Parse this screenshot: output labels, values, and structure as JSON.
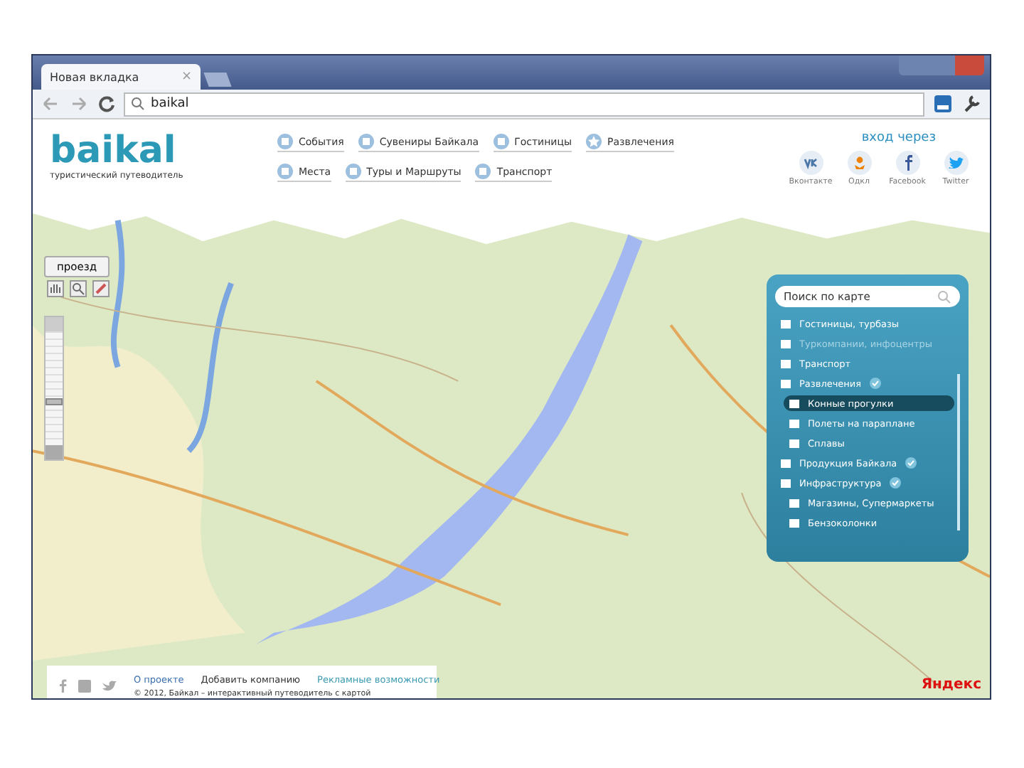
{
  "browser": {
    "tab": {
      "title": "Новая вкладка",
      "close": "×"
    },
    "address": "baikal"
  },
  "site": {
    "logo": "baikal",
    "tagline": "туристический путеводитель",
    "nav": [
      {
        "label": "События"
      },
      {
        "label": "Сувениры Байкала"
      },
      {
        "label": "Гостиницы"
      },
      {
        "label": "Развлечения"
      },
      {
        "label": "Места"
      },
      {
        "label": "Туры и Маршруты"
      },
      {
        "label": "Транспорт"
      }
    ],
    "login": {
      "title": "вход через",
      "networks": [
        {
          "label": "Вконтакте"
        },
        {
          "label": "Одкл"
        },
        {
          "label": "Facebook"
        },
        {
          "label": "Twitter"
        }
      ]
    }
  },
  "map": {
    "route_button": "проезд",
    "zoom": {
      "level": 0.35
    },
    "panel": {
      "search": {
        "placeholder": "Поиск по карте"
      },
      "items": [
        {
          "label": "Гостиницы, турбазы",
          "kind": "category",
          "selected": false,
          "disabled": false,
          "checked": false
        },
        {
          "label": "Туркомпании, инфоцентры",
          "kind": "category",
          "selected": false,
          "disabled": true,
          "checked": false
        },
        {
          "label": "Транспорт",
          "kind": "category",
          "selected": false,
          "disabled": false,
          "checked": false
        },
        {
          "label": "Развлечения",
          "kind": "category",
          "selected": false,
          "disabled": false,
          "checked": true
        },
        {
          "label": "Конные прогулки",
          "kind": "sub",
          "selected": true,
          "disabled": false,
          "checked": false
        },
        {
          "label": "Полеты на параплане",
          "kind": "sub",
          "selected": false,
          "disabled": false,
          "checked": false
        },
        {
          "label": "Сплавы",
          "kind": "sub",
          "selected": false,
          "disabled": false,
          "checked": false
        },
        {
          "label": "Продукция Байкала",
          "kind": "category",
          "selected": false,
          "disabled": false,
          "checked": true
        },
        {
          "label": "Инфраструктура",
          "kind": "category",
          "selected": false,
          "disabled": false,
          "checked": true
        },
        {
          "label": "Магазины, Супермаркеты",
          "kind": "sub",
          "selected": false,
          "disabled": false,
          "checked": false
        },
        {
          "label": "Бензоколонки",
          "kind": "sub",
          "selected": false,
          "disabled": false,
          "checked": false
        }
      ]
    },
    "provider": "Яндекс"
  },
  "footer": {
    "links": [
      "О проекте",
      "Добавить компанию",
      "Рекламные возможности"
    ],
    "copyright": "© 2012, Байкал – интерактивный путеводитель с картой"
  }
}
